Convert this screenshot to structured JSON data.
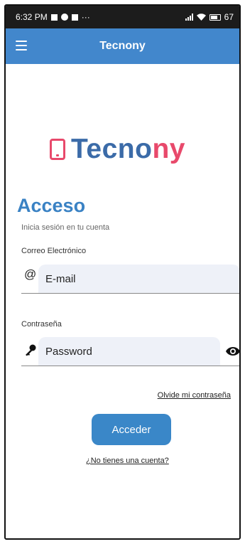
{
  "status_bar": {
    "time": "6:32 PM",
    "dots": "···",
    "battery": "67"
  },
  "app_bar": {
    "title": "Tecnony"
  },
  "logo": {
    "part1": "Tecno",
    "part2": "ny"
  },
  "login": {
    "heading": "Acceso",
    "subheading": "Inicia sesión en tu cuenta",
    "email_label": "Correo Electrónico",
    "email_icon": "@",
    "email_placeholder": "E-mail",
    "password_label": "Contraseña",
    "password_placeholder": "Password",
    "forgot": "Olvide mi contraseña",
    "submit": "Acceder",
    "register": "¿No tienes una cuenta?"
  },
  "colors": {
    "app_bar": "#4287cc",
    "brand_blue": "#3b6ba8",
    "brand_pink": "#e8496b",
    "button": "#3a87c8"
  }
}
